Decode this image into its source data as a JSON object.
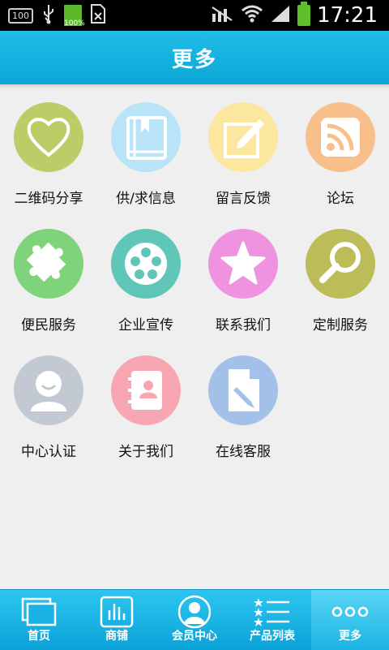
{
  "status_bar": {
    "left_badge": "100",
    "battery_percent_label": "100%",
    "time": "17:21"
  },
  "header": {
    "title": "更多"
  },
  "grid": {
    "items": [
      {
        "label": "二维码分享",
        "icon": "heart-icon",
        "color": "#bccc66"
      },
      {
        "label": "供/求信息",
        "icon": "book-icon",
        "color": "#b9e3f7"
      },
      {
        "label": "留言反馈",
        "icon": "edit-note-icon",
        "color": "#fbe7a0"
      },
      {
        "label": "论坛",
        "icon": "rss-icon",
        "color": "#f8bf8b"
      },
      {
        "label": "便民服务",
        "icon": "puzzle-icon",
        "color": "#7fd37a"
      },
      {
        "label": "企业宣传",
        "icon": "film-reel-icon",
        "color": "#60c6b7"
      },
      {
        "label": "联系我们",
        "icon": "star-icon",
        "color": "#ef93e0"
      },
      {
        "label": "定制服务",
        "icon": "magnifier-icon",
        "color": "#bcbd58"
      },
      {
        "label": "中心认证",
        "icon": "user-icon",
        "color": "#c2c9d3"
      },
      {
        "label": "关于我们",
        "icon": "contact-book-icon",
        "color": "#f7a6b2"
      },
      {
        "label": "在线客服",
        "icon": "document-edit-icon",
        "color": "#a3c0e9"
      }
    ]
  },
  "bottom_nav": {
    "items": [
      {
        "label": "首页",
        "icon": "home-screens-icon",
        "active": false
      },
      {
        "label": "商铺",
        "icon": "bar-chart-icon",
        "active": false
      },
      {
        "label": "会员中心",
        "icon": "member-avatar-icon",
        "active": false
      },
      {
        "label": "产品列表",
        "icon": "star-list-icon",
        "active": false
      },
      {
        "label": "更多",
        "icon": "more-dots-icon",
        "active": true
      }
    ]
  }
}
